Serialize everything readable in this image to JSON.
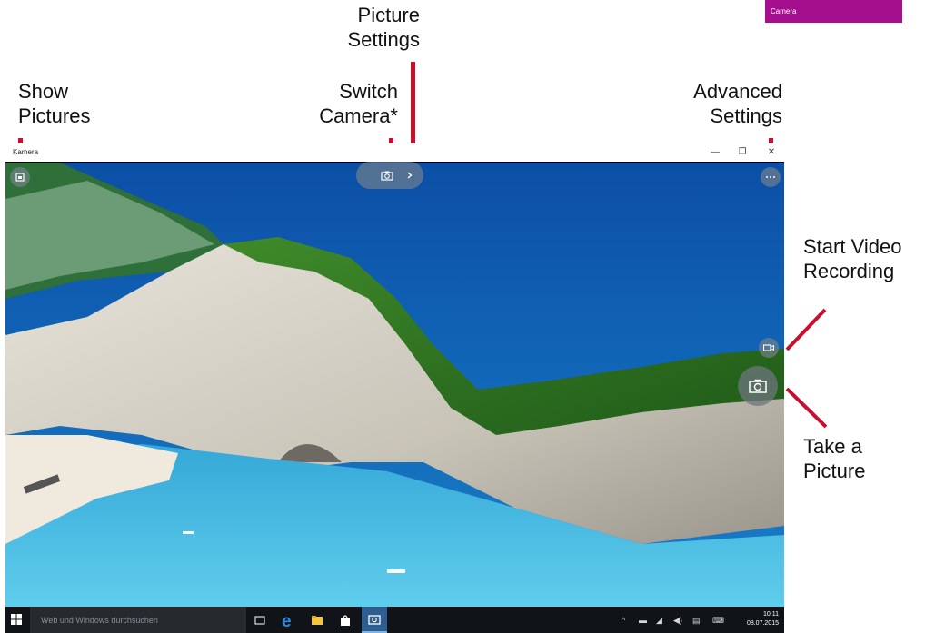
{
  "annotations": {
    "picture_settings": [
      "Picture",
      "Settings"
    ],
    "show_pictures": [
      "Show",
      "Pictures"
    ],
    "switch_camera": [
      "Switch",
      "Camera*"
    ],
    "advanced_settings": [
      "Advanced",
      "Settings"
    ],
    "start_video": [
      "Start Video",
      "Recording"
    ],
    "take_picture": [
      "Take a",
      "Picture"
    ]
  },
  "tile": {
    "label": "Camera"
  },
  "window": {
    "title": "Kamera",
    "minimize": "—",
    "restore": "❐",
    "close": "✕"
  },
  "taskbar": {
    "search_placeholder": "Web und Windows durchsuchen",
    "time": "10:11",
    "date": "08.07.2015"
  },
  "colors": {
    "annotation_line": "#c8102e",
    "tile": "#a50e8c",
    "taskbar": "#101418"
  },
  "icons": {
    "show_pictures": "gallery-icon",
    "switch_camera": "camera-icon",
    "picture_settings": "chevron-right-icon",
    "advanced_settings": "more-icon",
    "video": "video-camera-icon",
    "take_picture": "camera-icon"
  }
}
